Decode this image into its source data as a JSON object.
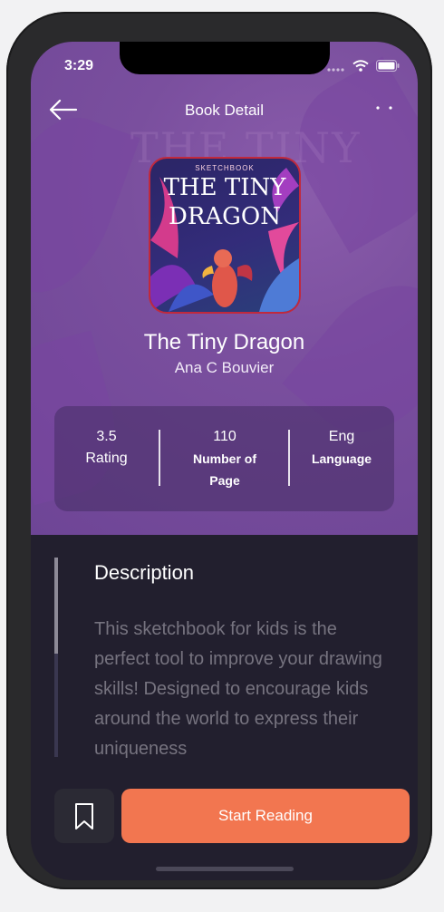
{
  "status_bar": {
    "time": "3:29"
  },
  "header": {
    "title": "Book Detail"
  },
  "cover": {
    "series_label": "SKETCHBOOK",
    "title_line1": "THE TINY",
    "title_line2": "DRAGON"
  },
  "background_title": "THE TINY",
  "book": {
    "title": "The Tiny Dragon",
    "author": "Ana C Bouvier"
  },
  "stats": [
    {
      "value": "3.5",
      "label": "Rating"
    },
    {
      "value": "110",
      "label": "Number of Page"
    },
    {
      "value": "Eng",
      "label": "Language"
    }
  ],
  "description": {
    "heading": "Description",
    "text": "This sketchbook for kids is the perfect tool to improve your drawing skills! Designed to encourage kids around the world to express their uniqueness"
  },
  "actions": {
    "start_label": "Start Reading"
  },
  "colors": {
    "accent": "#f27650",
    "hero": "#7a4f9e",
    "background": "#221f2e"
  },
  "icons": [
    "back-arrow-icon",
    "more-icon",
    "bookmark-icon",
    "wifi-icon",
    "signal-icon",
    "battery-icon"
  ]
}
